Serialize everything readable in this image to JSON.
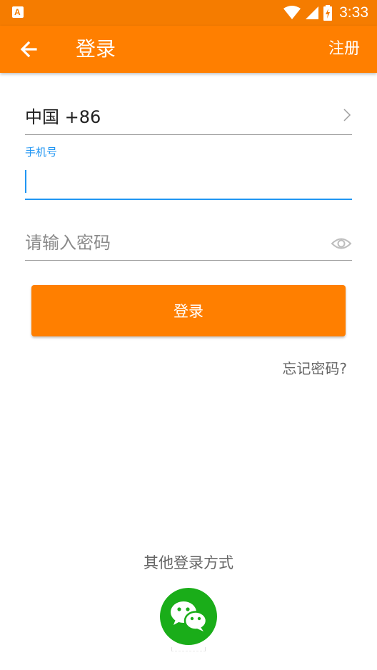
{
  "status_bar": {
    "time": "3:33",
    "icons": [
      "app-notification-icon",
      "wifi-icon",
      "signal-icon",
      "battery-charging-icon"
    ]
  },
  "app_bar": {
    "title": "登录",
    "action_label": "注册",
    "back_icon": "arrow-back-icon"
  },
  "form": {
    "country": "中国 +86",
    "phone_label": "手机号",
    "phone_value": "",
    "password_placeholder": "请输入密码",
    "login_label": "登录",
    "forgot_label": "忘记密码?"
  },
  "other_login": {
    "label": "其他登录方式",
    "methods": [
      "wechat-icon"
    ]
  },
  "colors": {
    "primary": "#FF7F00",
    "accent": "#2196F3",
    "wechat": "#1AAD19"
  }
}
